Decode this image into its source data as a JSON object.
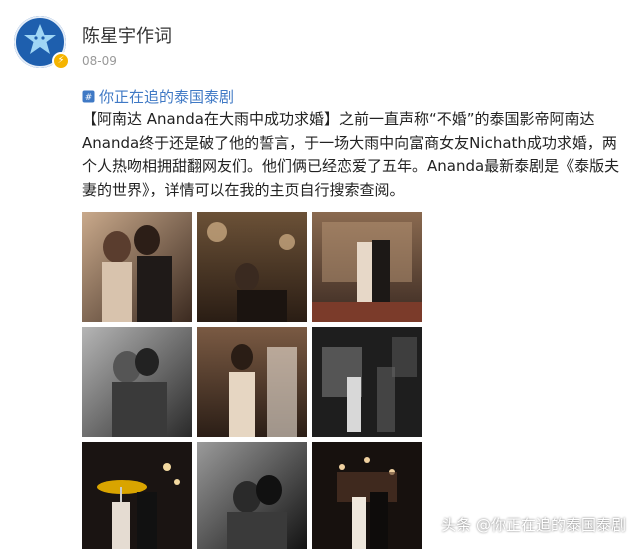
{
  "post": {
    "author": "陈星宇作词",
    "date": "08-09",
    "topic": "你正在追的泰国泰剧",
    "text": "【阿南达 Ananda在大雨中成功求婚】之前一直声称“不婚”的泰国影帝阿南达Ananda终于还是破了他的誓言，于一场大雨中向富商女友Nichath成功求婚，两个人热吻相拥甜翻网友们。他们俩已经恋爱了五年。Ananda最新泰剧是《泰版夫妻的世界》，详情可以在我的主页自行搜索查阅。"
  },
  "watermark": "头条 @你正在追的泰国泰剧",
  "icons": {
    "verified_badge": "verified-badge-icon",
    "topic": "topic-icon"
  },
  "colors": {
    "topic_link": "#3f79c5",
    "date": "#999999",
    "badge": "#f5b400",
    "avatar_bg": "#1e5fae"
  },
  "photos": [
    {
      "name": "photo-1",
      "theme": "warm"
    },
    {
      "name": "photo-2",
      "theme": "warm"
    },
    {
      "name": "photo-3",
      "theme": "warm"
    },
    {
      "name": "photo-4",
      "theme": "mono"
    },
    {
      "name": "photo-5",
      "theme": "warm"
    },
    {
      "name": "photo-6",
      "theme": "mono"
    },
    {
      "name": "photo-7",
      "theme": "dark"
    },
    {
      "name": "photo-8",
      "theme": "mono"
    },
    {
      "name": "photo-9",
      "theme": "dark"
    }
  ]
}
